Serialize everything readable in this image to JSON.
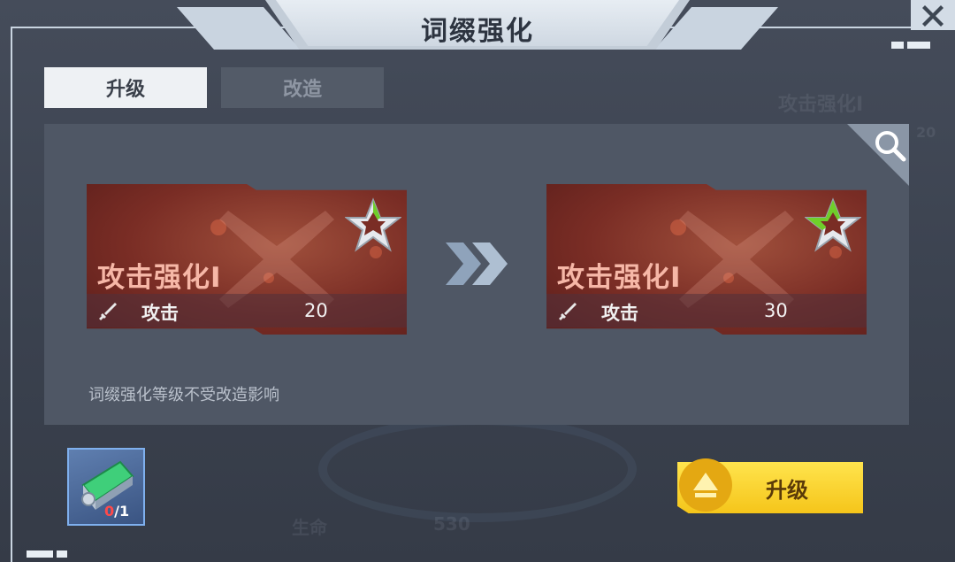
{
  "dialog": {
    "title": "词缀强化",
    "close_icon": "close-x-icon"
  },
  "tabs": [
    {
      "label": "升级",
      "active": true
    },
    {
      "label": "改造",
      "active": false
    }
  ],
  "comparison": {
    "before": {
      "name": "攻击强化I",
      "stat_label": "攻击",
      "stat_value": "20",
      "stat_icon": "sword-icon"
    },
    "after": {
      "name": "攻击强化I",
      "stat_label": "攻击",
      "stat_value": "30",
      "stat_icon": "sword-icon"
    },
    "arrow_icon": "double-chevron-right-icon",
    "zoom_icon": "magnifier-icon"
  },
  "note": "词缀强化等级不受改造影响",
  "material": {
    "icon": "upgrade-chip-icon",
    "have": "0",
    "separator": "/",
    "need": "1"
  },
  "upgrade_button": {
    "label": "升级",
    "icon": "up-arrow-icon"
  },
  "background": {
    "ghost_labels": [
      "攻击强化I",
      "20",
      "生命",
      "530"
    ]
  },
  "colors": {
    "panel": "#4f5765",
    "card_red": "#7a2d25",
    "card_title": "#f6b7a7",
    "star_green": "#6fcf2a",
    "button_yellow": "#f5c51a",
    "count_red": "#ff4a4a"
  }
}
